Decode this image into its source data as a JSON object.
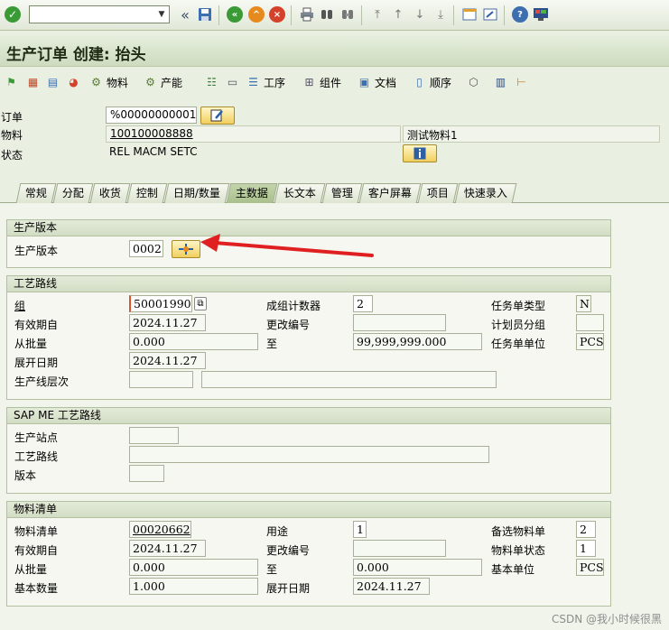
{
  "toolbar": {
    "command_value": "",
    "icons": [
      "ok-icon",
      "back-double-icon",
      "save-icon",
      "back-icon",
      "exit-icon",
      "cancel-icon",
      "print-icon",
      "find-icon",
      "find-next-icon",
      "first-page-icon",
      "prev-page-icon",
      "next-page-icon",
      "last-page-icon",
      "new-session-icon",
      "shortcut-icon",
      "help-icon",
      "layout-icon"
    ]
  },
  "title": "生产订单 创建: 抬头",
  "app_toolbar": {
    "material": "物料",
    "capacity": "产能",
    "operations": "工序",
    "components": "组件",
    "documents": "文档",
    "sequence": "顺序"
  },
  "header": {
    "order_label": "订单",
    "order_value": "%00000000001",
    "material_label": "物料",
    "material_value": "100100008888",
    "material_desc": "测试物料1",
    "status_label": "状态",
    "status_value": "REL  MACM SETC"
  },
  "tabs": [
    "常规",
    "分配",
    "收货",
    "控制",
    "日期/数量",
    "主数据",
    "长文本",
    "管理",
    "客户屏幕",
    "项目",
    "快速录入"
  ],
  "active_tab": "主数据",
  "prod_version": {
    "title": "生产版本",
    "label": "生产版本",
    "value": "0002"
  },
  "routing": {
    "title": "工艺路线",
    "group_label": "组",
    "group_value": "50001990",
    "valid_from_label": "有效期自",
    "valid_from_value": "2024.11.27",
    "from_lot_label": "从批量",
    "from_lot_value": "0.000",
    "explosion_date_label": "展开日期",
    "explosion_date_value": "2024.11.27",
    "line_hierarchy_label": "生产线层次",
    "line_hierarchy_value": "",
    "group_counter_label": "成组计数器",
    "group_counter_value": "2",
    "change_no_label": "更改编号",
    "change_no_value": "",
    "to_label": "至",
    "to_value": "99,999,999.000",
    "task_list_type_label": "任务单类型",
    "task_list_type_value": "N",
    "planner_group_label": "计划员分组",
    "planner_group_value": "",
    "task_list_unit_label": "任务单单位",
    "task_list_unit_value": "PCS"
  },
  "sapme": {
    "title": "SAP ME 工艺路线",
    "site_label": "生产站点",
    "site_value": "",
    "routing_label": "工艺路线",
    "routing_value": "",
    "version_label": "版本",
    "version_value": ""
  },
  "bom": {
    "title": "物料清单",
    "bom_label": "物料清单",
    "bom_value": "00020662",
    "valid_from_label": "有效期自",
    "valid_from_value": "2024.11.27",
    "from_lot_label": "从批量",
    "from_lot_value": "0.000",
    "base_qty_label": "基本数量",
    "base_qty_value": "1.000",
    "usage_label": "用途",
    "usage_value": "1",
    "change_no_label": "更改编号",
    "change_no_value": "",
    "to_label": "至",
    "to_value": "0.000",
    "explosion_date_label": "展开日期",
    "explosion_date_value": "2024.11.27",
    "alt_bom_label": "备选物料单",
    "alt_bom_value": "2",
    "bom_status_label": "物料单状态",
    "bom_status_value": "1",
    "base_unit_label": "基本单位",
    "base_unit_value": "PCS"
  },
  "watermark": "CSDN @我小时候很黑",
  "colors": {
    "accent_green": "#3a9a35",
    "arrow_red": "#e02020",
    "button_yellow": "#f1cf5e"
  }
}
